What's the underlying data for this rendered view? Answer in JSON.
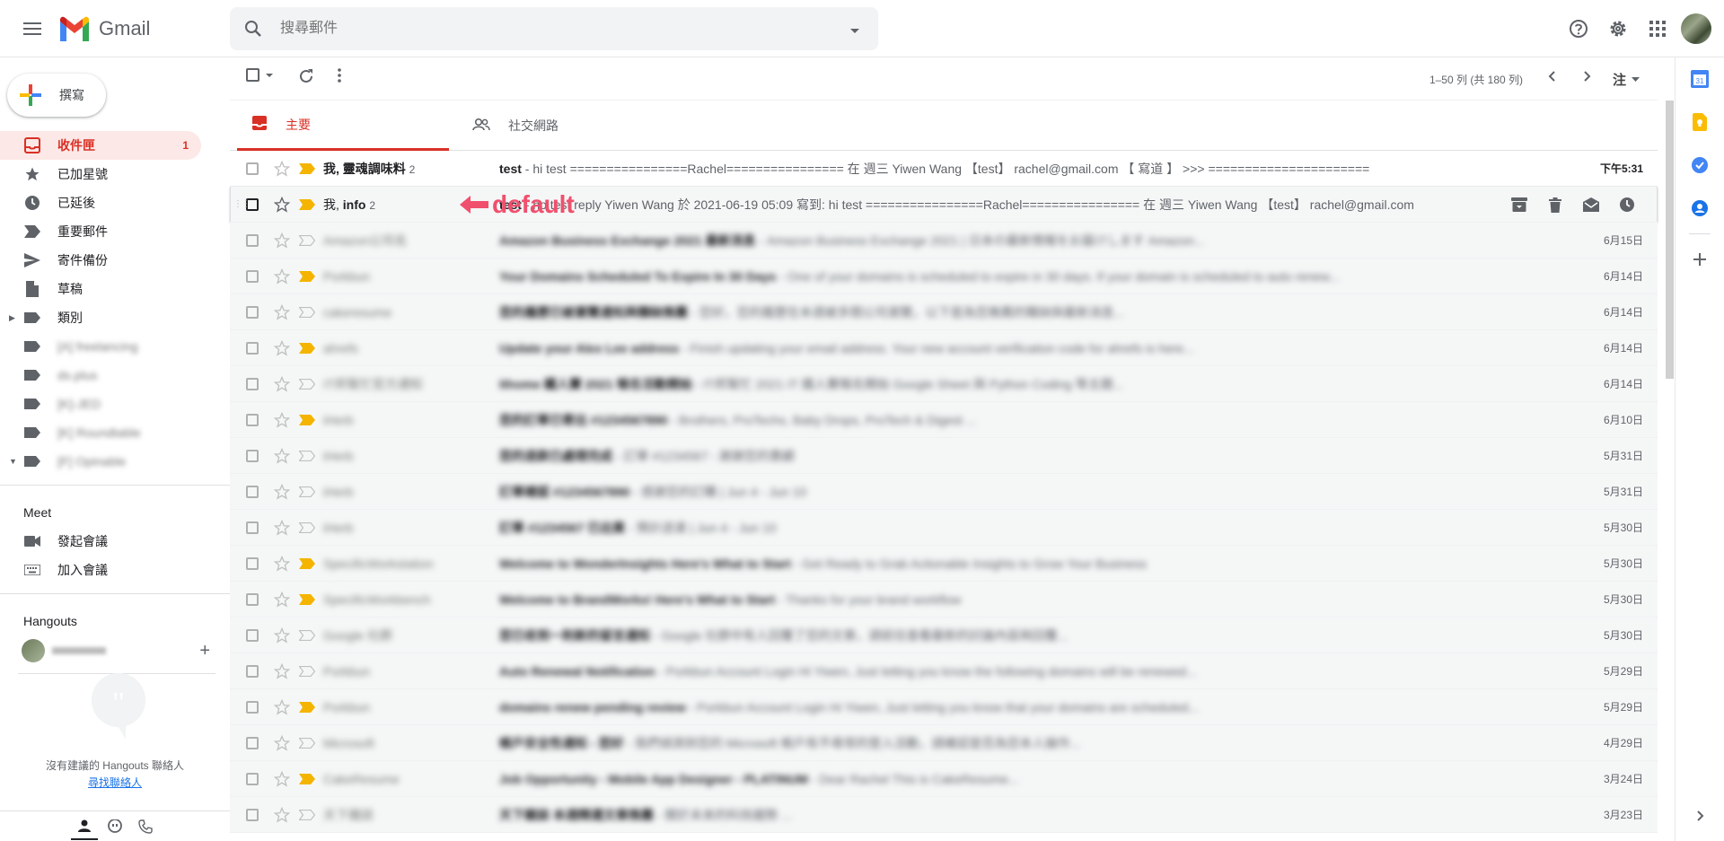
{
  "header": {
    "app_name": "Gmail",
    "search_placeholder": "搜尋郵件",
    "icons": [
      "menu-icon",
      "search-icon",
      "help-icon",
      "gear-icon",
      "apps-icon",
      "avatar"
    ]
  },
  "sidebar": {
    "compose_label": "撰寫",
    "items": [
      {
        "label": "收件匣",
        "count": "1",
        "icon": "inbox-icon",
        "active": true
      },
      {
        "label": "已加星號",
        "icon": "star-icon"
      },
      {
        "label": "已延後",
        "icon": "clock-icon"
      },
      {
        "label": "重要郵件",
        "icon": "label-important-icon"
      },
      {
        "label": "寄件備份",
        "icon": "send-icon"
      },
      {
        "label": "草稿",
        "icon": "draft-icon"
      },
      {
        "label": "類別",
        "icon": "label-icon"
      },
      {
        "label": "[A] freelancing",
        "icon": "label-icon",
        "blurred": true
      },
      {
        "label": "ds.plus",
        "icon": "label-icon",
        "blurred": true
      },
      {
        "label": "[K]-JED",
        "icon": "label-icon",
        "blurred": true
      },
      {
        "label": "[K] Roundtable",
        "icon": "label-icon",
        "blurred": true
      },
      {
        "label": "[F] Opinable",
        "icon": "label-icon",
        "blurred": true
      }
    ],
    "meet": {
      "title": "Meet",
      "items": [
        {
          "label": "發起會議",
          "icon": "video-icon"
        },
        {
          "label": "加入會議",
          "icon": "keyboard-icon"
        }
      ]
    },
    "hangouts": {
      "title": "Hangouts",
      "empty_text": "沒有建議的 Hangouts 聯絡人",
      "link_text": "尋找聯絡人"
    }
  },
  "toolbar": {
    "pagination": "1–50 列 (共 180 列)",
    "sort_label": "注"
  },
  "tabs": [
    {
      "label": "主要",
      "icon": "inbox-icon",
      "active": true
    },
    {
      "label": "社交網路",
      "icon": "people-icon",
      "active": false
    }
  ],
  "annotation": "default",
  "emails": [
    {
      "sender": "我, 靈魂調味料",
      "sender_count": "2",
      "subject": "test",
      "snippet": " - hi test ================Rachel================ 在 週三 Yiwen Wang 【test】 rachel@gmail.com 【 寫道 】 >>> ======================",
      "date": "下午5:31",
      "unread": true,
      "important": true,
      "starred": false
    },
    {
      "sender": "我, info",
      "sender_count": "2",
      "subject": "test",
      "snippet": " - ho test reply Yiwen Wang 於 2021-06-19 05:09 寫到: hi test ================Rachel================ 在 週三 Yiwen Wang 【test】 rachel@gmail.com",
      "date": "",
      "unread": false,
      "important": true,
      "hovered": true
    },
    {
      "sender": "Amazon公司名",
      "subject": "Amazon Business Exchange 2021 最新消息",
      "snippet": " - Amazon Business Exchange 2021 | 日本の最新情報をお届けします Amazon...",
      "date": "6月15日",
      "blurred": true,
      "important": false
    },
    {
      "sender": "Porkbun",
      "subject": "Your Domains Scheduled To Expire In 30 Days",
      "snippet": " - One of your domains is scheduled to expire in 30 days. If your domain is scheduled to auto renew...",
      "date": "6月14日",
      "blurred": true,
      "important": true
    },
    {
      "sender": "cakeresume",
      "subject": "您的履歷已被瀏覽通知與職缺推薦",
      "snippet": " - 您好，您的履歷在本週被多間公司瀏覽，以下是為您推薦的職缺與最新消息...",
      "date": "6月14日",
      "blurred": true,
      "important": false
    },
    {
      "sender": "ahrefs",
      "subject": "Update your Alex Lee address",
      "snippet": " - Finish updating your email address. Your new account verification code for ahrefs is here...",
      "date": "6月14日",
      "blurred": true,
      "important": true
    },
    {
      "sender": "IT邦幫忙官方通知",
      "subject": "Ithome 鐵人賽 2021 報名活動開始",
      "snippet": " - IT邦幫忙 2021 IT 鐵人賽報名開始 Google Sheet 與 Python Coding 等主題...",
      "date": "6月14日",
      "blurred": true,
      "important": false
    },
    {
      "sender": "iHerb",
      "subject": "您的訂單已寄出 #1234567890",
      "snippet": " - Brothers, ProTechs, Baby Drops, ProTech & Digest ...",
      "date": "6月10日",
      "blurred": true,
      "important": true
    },
    {
      "sender": "iHerb",
      "subject": "您的退款已處理完成",
      "snippet": " - 訂單 #1234567 - 謝謝您的惠顧",
      "date": "5月31日",
      "blurred": true,
      "important": false
    },
    {
      "sender": "iHerb",
      "subject": "訂單確認 #1234567890",
      "snippet": " - 感謝您的訂購 | Jun 4 - Jun 10",
      "date": "5月31日",
      "blurred": true,
      "important": false
    },
    {
      "sender": "iHerb",
      "subject": "訂單 #1234567 已出貨",
      "snippet": " - 預計送達 | Jun 4 - Jun 10",
      "date": "5月30日",
      "blurred": true,
      "important": false
    },
    {
      "sender": "SpecificWorkstation",
      "subject": "Welcome to WonderInsights Here's What to Start",
      "snippet": " - Get Ready to Grab Actionable Insights to Grow Your Business",
      "date": "5月30日",
      "blurred": true,
      "important": true
    },
    {
      "sender": "SpecificWorkbench",
      "subject": "Welcome to BrandWorks! Here's What to Start",
      "snippet": " - Thanks for your brand workflow",
      "date": "5月30日",
      "blurred": true,
      "important": true
    },
    {
      "sender": "Google 社群",
      "subject": "您已收到一則新的留言通知",
      "snippet": " - Google 社群中有人回覆了您的文章，請前往查看最新的討論內容與回覆...",
      "date": "5月30日",
      "blurred": true,
      "important": false
    },
    {
      "sender": "Porkbun",
      "subject": "Auto Renewal Notification",
      "snippet": " - Porkbun Account Login Hi Yiwen, Just letting you know the following domains will be renewed...",
      "date": "5月29日",
      "blurred": true,
      "important": false
    },
    {
      "sender": "Porkbun",
      "subject": "domains renew pending review",
      "snippet": " - Porkbun Account Login Hi Yiwen, Just letting you know that your domains are scheduled...",
      "date": "5月29日",
      "blurred": true,
      "important": true
    },
    {
      "sender": "Microsoft",
      "subject": "帳戶安全性通知 - 您好",
      "snippet": " - 我們偵測到您的 Microsoft 帳戶有不尋常的登入活動，請確認是否為您本人操作...",
      "date": "4月29日",
      "blurred": true,
      "important": false
    },
    {
      "sender": "CakeResume",
      "subject": "Job Opportunity - Mobile App Designer - PLATINUM",
      "snippet": " - Dear Rachel This is CakeResume...",
      "date": "3月24日",
      "blurred": true,
      "important": true
    },
    {
      "sender": "天下雜誌",
      "subject": "天下雜誌 本週精選文章推薦",
      "snippet": " - 關於未來的科技趨勢 ...",
      "date": "3月23日",
      "blurred": true,
      "important": false
    }
  ],
  "colors": {
    "accent_red": "#d93025",
    "active_bg": "#fce8e6",
    "important_yellow": "#f4b400",
    "annotation_pink": "#f0506e"
  }
}
